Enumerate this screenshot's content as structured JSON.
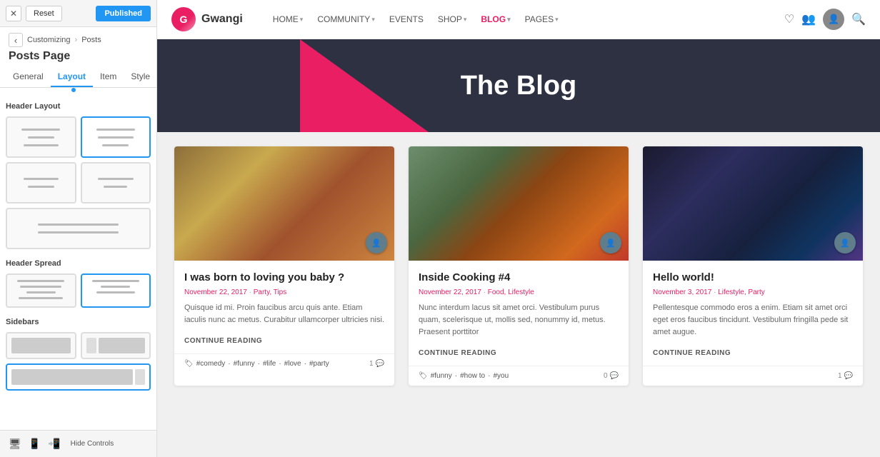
{
  "panel": {
    "topbar": {
      "reset_label": "Reset",
      "published_label": "Published"
    },
    "breadcrumb": {
      "back_icon": "‹",
      "customizing": "Customizing",
      "separator": "›",
      "section": "Posts"
    },
    "title": "Posts Page",
    "tabs": [
      {
        "id": "general",
        "label": "General"
      },
      {
        "id": "layout",
        "label": "Layout",
        "active": true
      },
      {
        "id": "item",
        "label": "Item"
      },
      {
        "id": "style",
        "label": "Style"
      }
    ],
    "sections": {
      "header_layout": "Header Layout",
      "header_spread": "Header Spread",
      "sidebars": "Sidebars"
    }
  },
  "navbar": {
    "logo_letter": "G",
    "logo_text": "Gwangi",
    "links": [
      {
        "label": "HOME",
        "has_dropdown": true
      },
      {
        "label": "COMMUNITY",
        "has_dropdown": true
      },
      {
        "label": "EVENTS",
        "has_dropdown": false
      },
      {
        "label": "SHOP",
        "has_dropdown": true
      },
      {
        "label": "BLOG",
        "has_dropdown": true,
        "active": true
      },
      {
        "label": "PAGES",
        "has_dropdown": true
      }
    ]
  },
  "hero": {
    "title": "The Blog"
  },
  "posts": [
    {
      "id": 1,
      "title": "I was born to loving you baby ?",
      "date": "November 22, 2017",
      "categories": "Party, Tips",
      "excerpt": "Quisque id mi. Proin faucibus arcu quis ante. Etiam iaculis nunc ac metus. Curabitur ullamcorper ultricies nisi.",
      "continue_label": "CONTINUE READING",
      "tags": [
        "#comedy",
        "#funny",
        "#life",
        "#love",
        "#party"
      ],
      "comments_count": "1",
      "img_class": "img-leaf"
    },
    {
      "id": 2,
      "title": "Inside Cooking #4",
      "date": "November 22, 2017",
      "categories": "Food, Lifestyle",
      "excerpt": "Nunc interdum lacus sit amet orci. Vestibulum purus quam, scelerisque ut, mollis sed, nonummy id, metus. Praesent porttitor",
      "continue_label": "CONTINUE READING",
      "tags": [
        "#funny",
        "#how to",
        "#you"
      ],
      "comments_count": "0",
      "img_class": "img-food"
    },
    {
      "id": 3,
      "title": "Hello world!",
      "date": "November 3, 2017",
      "categories": "Lifestyle, Party",
      "excerpt": "Pellentesque commodo eros a enim. Etiam sit amet orci eget eros faucibus tincidunt. Vestibulum fringilla pede sit amet augue.",
      "continue_label": "CONTINUE READING",
      "tags": [],
      "comments_count": "1",
      "img_class": "img-night"
    }
  ],
  "bottom_toolbar": {
    "hide_controls": "Hide Controls"
  }
}
